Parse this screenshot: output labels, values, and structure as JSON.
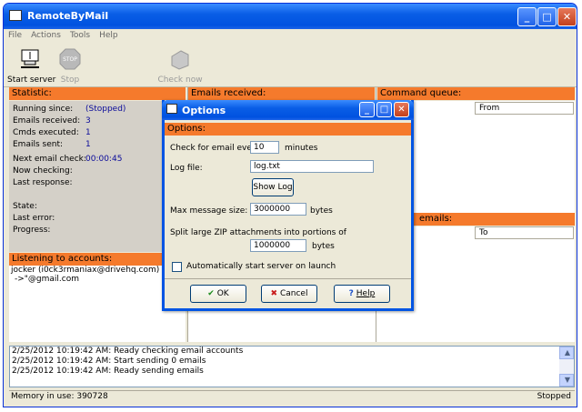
{
  "app": {
    "title": "RemoteByMail"
  },
  "menu": [
    "File",
    "Actions",
    "Tools",
    "Help"
  ],
  "toolbar": {
    "start": "Start server",
    "stop": "Stop",
    "check": "Check now",
    "stop_icon_text": "STOP"
  },
  "statistic": {
    "header": "Statistic:",
    "running_since_label": "Running since:",
    "running_since": "(Stopped)",
    "emails_received_label": "Emails received:",
    "emails_received": "3",
    "cmds_label": "Cmds executed:",
    "cmds": "1",
    "emails_sent_label": "Emails sent:",
    "emails_sent": "1",
    "next_check_label": "Next email check:",
    "next_check": "00:00:45",
    "now_checking_label": "Now checking:",
    "last_response_label": "Last response:",
    "state_label": "State:",
    "last_error_label": "Last error:",
    "progress_label": "Progress:"
  },
  "listening": {
    "header": "Listening to accounts:",
    "accounts": [
      "jocker (i0ck3rmaniax@drivehq.com)",
      "->\"@gmail.com"
    ]
  },
  "emails_received": {
    "header": "Emails received:"
  },
  "command_queue": {
    "header": "Command queue:",
    "col_from": "From"
  },
  "emails_panel": {
    "header": "emails:",
    "col_to": "To"
  },
  "log": [
    "2/25/2012 10:19:42 AM: Ready checking email accounts",
    "2/25/2012 10:19:42 AM: Start sending 0 emails",
    "2/25/2012 10:19:42 AM: Ready sending emails"
  ],
  "status": {
    "memory": "Memory in use: 390728",
    "state": "Stopped"
  },
  "options": {
    "title": "Options",
    "header": "Options:",
    "check_every_label": "Check for email every",
    "check_every": "10",
    "minutes": "minutes",
    "logfile_label": "Log file:",
    "logfile": "log.txt",
    "show_log": "Show Log",
    "max_size_label": "Max message size:",
    "max_size": "3000000",
    "bytes": "bytes",
    "split_label": "Split large ZIP attachments into portions of",
    "split": "1000000",
    "bytes2": "bytes",
    "autostart_label": "Automatically start server on launch",
    "ok": "OK",
    "cancel": "Cancel",
    "help": "Help"
  },
  "colors": {
    "accent": "#f57a2c",
    "title_blue": "#0054e3"
  }
}
